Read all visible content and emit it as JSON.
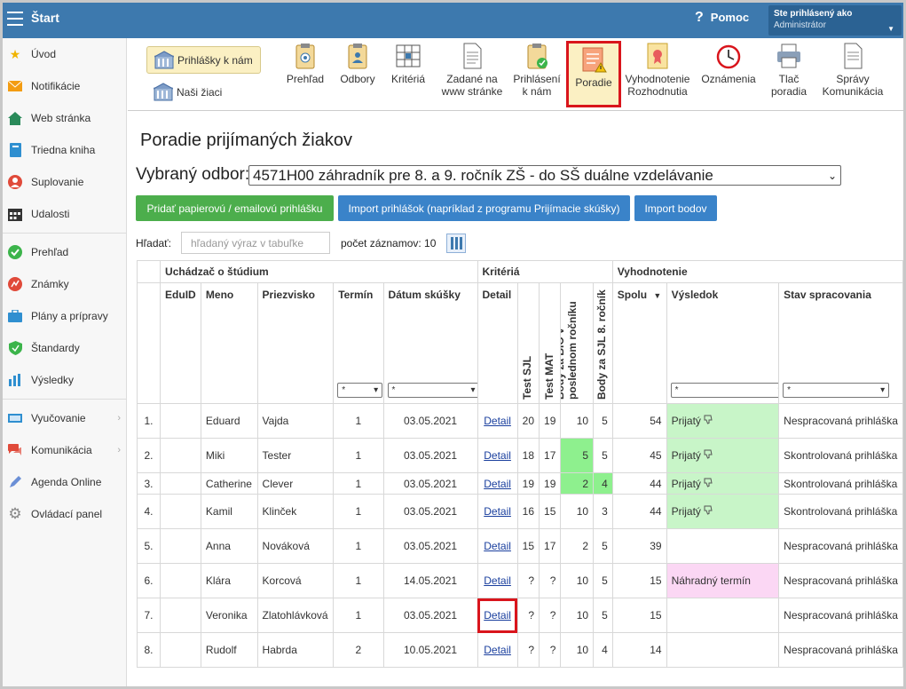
{
  "header": {
    "app_title": "Štart",
    "help_label": "Pomoc",
    "user_line1": "Ste prihlásený ako",
    "user_line2": "Administrátor"
  },
  "sidebar": {
    "items": [
      {
        "label": "Úvod",
        "icon": "star-icon"
      },
      {
        "label": "Notifikácie",
        "icon": "envelope-icon"
      },
      {
        "label": "Web stránka",
        "icon": "home-icon"
      },
      {
        "label": "Triedna kniha",
        "icon": "book-icon"
      },
      {
        "label": "Suplovanie",
        "icon": "user-icon"
      },
      {
        "label": "Udalosti",
        "icon": "calendar-icon"
      },
      {
        "label": "Prehľad",
        "icon": "check-circle-icon"
      },
      {
        "label": "Známky",
        "icon": "chart-icon"
      },
      {
        "label": "Plány a prípravy",
        "icon": "briefcase-icon"
      },
      {
        "label": "Štandardy",
        "icon": "shield-icon"
      },
      {
        "label": "Výsledky",
        "icon": "bar-chart-icon"
      },
      {
        "label": "Vyučovanie",
        "icon": "board-icon"
      },
      {
        "label": "Komunikácia",
        "icon": "chat-icon"
      },
      {
        "label": "Agenda Online",
        "icon": "pen-icon"
      },
      {
        "label": "Ovládací panel",
        "icon": "gear-icon"
      }
    ]
  },
  "toolbar": {
    "left_buttons": [
      "Prihlášky k nám",
      "Naši žiaci"
    ],
    "buttons": [
      {
        "label1": "Prehľad",
        "label2": ""
      },
      {
        "label1": "Odbory",
        "label2": ""
      },
      {
        "label1": "Kritériá",
        "label2": ""
      },
      {
        "label1": "Zadané na",
        "label2": "www stránke"
      },
      {
        "label1": "Prihlásení",
        "label2": "k nám"
      },
      {
        "label1": "Poradie",
        "label2": ""
      },
      {
        "label1": "Vyhodnotenie",
        "label2": "Rozhodnutia"
      },
      {
        "label1": "Oznámenia",
        "label2": ""
      },
      {
        "label1": "Tlač",
        "label2": "poradia"
      },
      {
        "label1": "Správy",
        "label2": "Komunikácia"
      }
    ]
  },
  "page": {
    "title": "Poradie prijímaných žiakov",
    "odbor_label": "Vybraný odbor:",
    "odbor_value": "4571H00 záhradník pre 8. a 9. ročník ZŠ - do SŠ duálne vzdelávanie",
    "btn_paper": "Pridať papierovú / emailovú prihlášku",
    "btn_import": "Import prihlášok (napríklad z programu Prijímacie skúšky)",
    "btn_points": "Import bodov",
    "search_label": "Hľadať:",
    "search_placeholder": "hľadaný výraz v tabuľke",
    "count_label": "počet záznamov: 10"
  },
  "table": {
    "groups": [
      "Uchádzač o štúdium",
      "Kritériá",
      "Vyhodnotenie"
    ],
    "columns": [
      "EduID",
      "Meno",
      "Priezvisko",
      "Termín",
      "Dátum skúšky",
      "Detail",
      "Test SJL",
      "Test MAT",
      "Body za BIO v poslednom ročníku",
      "Body za SJL 8. ročník",
      "Spolu",
      "Výsledok",
      "Stav spracovania"
    ],
    "filter_value": "*",
    "rows": [
      {
        "n": "1.",
        "meno": "Eduard",
        "priezvisko": "Vajda",
        "termin": "1",
        "datum": "03.05.2021",
        "detail": "Detail",
        "sjl": "20",
        "mat": "19",
        "bio": "10",
        "sjl8": "5",
        "spolu": "54",
        "vysledok": "Prijatý",
        "stav": "Nespracovaná prihláška"
      },
      {
        "n": "2.",
        "meno": "Miki",
        "priezvisko": "Tester",
        "termin": "1",
        "datum": "03.05.2021",
        "detail": "Detail",
        "sjl": "18",
        "mat": "17",
        "bio": "5",
        "sjl8": "5",
        "spolu": "45",
        "vysledok": "Prijatý",
        "stav": "Skontrolovaná prihláška"
      },
      {
        "n": "3.",
        "meno": "Catherine",
        "priezvisko": "Clever",
        "termin": "1",
        "datum": "03.05.2021",
        "detail": "Detail",
        "sjl": "19",
        "mat": "19",
        "bio": "2",
        "sjl8": "4",
        "spolu": "44",
        "vysledok": "Prijatý",
        "stav": "Skontrolovaná prihláška"
      },
      {
        "n": "4.",
        "meno": "Kamil",
        "priezvisko": "Klinček",
        "termin": "1",
        "datum": "03.05.2021",
        "detail": "Detail",
        "sjl": "16",
        "mat": "15",
        "bio": "10",
        "sjl8": "3",
        "spolu": "44",
        "vysledok": "Prijatý",
        "stav": "Skontrolovaná prihláška"
      },
      {
        "n": "5.",
        "meno": "Anna",
        "priezvisko": "Nováková",
        "termin": "1",
        "datum": "03.05.2021",
        "detail": "Detail",
        "sjl": "15",
        "mat": "17",
        "bio": "2",
        "sjl8": "5",
        "spolu": "39",
        "vysledok": "",
        "stav": "Nespracovaná prihláška"
      },
      {
        "n": "6.",
        "meno": "Klára",
        "priezvisko": "Korcová",
        "termin": "1",
        "datum": "14.05.2021",
        "detail": "Detail",
        "sjl": "?",
        "mat": "?",
        "bio": "10",
        "sjl8": "5",
        "spolu": "15",
        "vysledok": "Náhradný termín",
        "stav": "Nespracovaná prihláška"
      },
      {
        "n": "7.",
        "meno": "Veronika",
        "priezvisko": "Zlatohlávková",
        "termin": "1",
        "datum": "03.05.2021",
        "detail": "Detail",
        "sjl": "?",
        "mat": "?",
        "bio": "10",
        "sjl8": "5",
        "spolu": "15",
        "vysledok": "",
        "stav": "Nespracovaná prihláška"
      },
      {
        "n": "8.",
        "meno": "Rudolf",
        "priezvisko": "Habrda",
        "termin": "2",
        "datum": "10.05.2021",
        "detail": "Detail",
        "sjl": "?",
        "mat": "?",
        "bio": "10",
        "sjl8": "4",
        "spolu": "14",
        "vysledok": "",
        "stav": "Nespracovaná prihláška"
      }
    ]
  },
  "colors": {
    "topbar": "#3d79ae",
    "green_button": "#4cae4c",
    "blue_button": "#3a83c9",
    "accepted": "#c8f5c8",
    "highlight_cell": "#8ef08e",
    "substitute": "#fbd7f4",
    "highlight_box": "#d9151c"
  }
}
